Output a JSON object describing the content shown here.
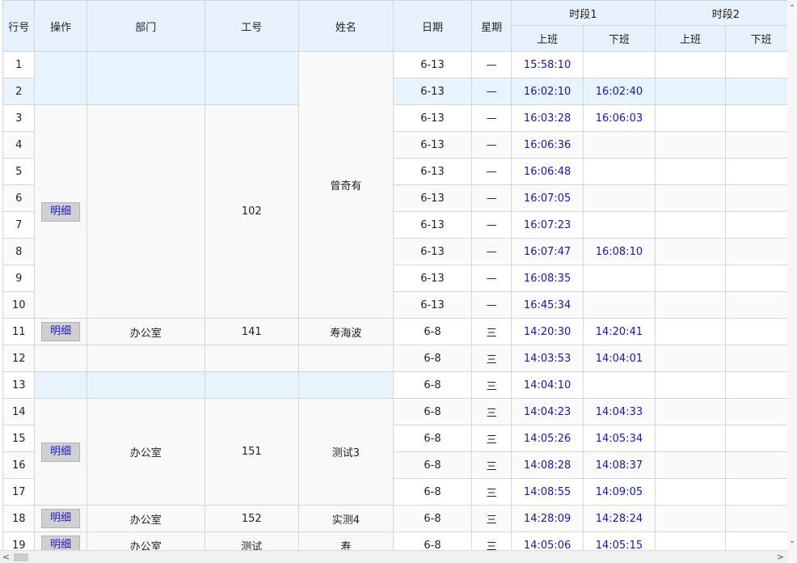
{
  "header": {
    "row_no": "行号",
    "action": "操作",
    "dept": "部门",
    "emp_no": "工号",
    "name": "姓名",
    "date": "日期",
    "weekday": "星期",
    "period1": "时段1",
    "period2": "时段2",
    "on": "上班",
    "off": "下班",
    "on2": "上班",
    "off2": "下班"
  },
  "detail_label": "明细",
  "groups": [
    {
      "dept": "",
      "emp_no": "102",
      "name": "曾奇有"
    },
    {
      "dept": "办公室",
      "emp_no": "141",
      "name": "寿海波"
    },
    {
      "dept": "办公室",
      "emp_no": "151",
      "name": "测试3"
    },
    {
      "dept": "办公室",
      "emp_no": "152",
      "name": "实测4"
    },
    {
      "dept": "办公室",
      "emp_no": "测试",
      "name": "寿"
    }
  ],
  "rows": [
    {
      "no": "1",
      "date": "6-13",
      "weekday": "—",
      "on1": "15:58:10",
      "off1": ""
    },
    {
      "no": "2",
      "date": "6-13",
      "weekday": "—",
      "on1": "16:02:10",
      "off1": "16:02:40"
    },
    {
      "no": "3",
      "date": "6-13",
      "weekday": "—",
      "on1": "16:03:28",
      "off1": "16:06:03"
    },
    {
      "no": "4",
      "date": "6-13",
      "weekday": "—",
      "on1": "16:06:36",
      "off1": ""
    },
    {
      "no": "5",
      "date": "6-13",
      "weekday": "—",
      "on1": "16:06:48",
      "off1": ""
    },
    {
      "no": "6",
      "date": "6-13",
      "weekday": "—",
      "on1": "16:07:05",
      "off1": ""
    },
    {
      "no": "7",
      "date": "6-13",
      "weekday": "—",
      "on1": "16:07:23",
      "off1": ""
    },
    {
      "no": "8",
      "date": "6-13",
      "weekday": "—",
      "on1": "16:07:47",
      "off1": "16:08:10"
    },
    {
      "no": "9",
      "date": "6-13",
      "weekday": "—",
      "on1": "16:08:35",
      "off1": ""
    },
    {
      "no": "10",
      "date": "6-13",
      "weekday": "—",
      "on1": "16:45:34",
      "off1": ""
    },
    {
      "no": "11",
      "date": "6-8",
      "weekday": "三",
      "on1": "14:20:30",
      "off1": "14:20:41"
    },
    {
      "no": "12",
      "date": "6-8",
      "weekday": "三",
      "on1": "14:03:53",
      "off1": "14:04:01"
    },
    {
      "no": "13",
      "date": "6-8",
      "weekday": "三",
      "on1": "14:04:10",
      "off1": ""
    },
    {
      "no": "14",
      "date": "6-8",
      "weekday": "三",
      "on1": "14:04:23",
      "off1": "14:04:33"
    },
    {
      "no": "15",
      "date": "6-8",
      "weekday": "三",
      "on1": "14:05:26",
      "off1": "14:05:34"
    },
    {
      "no": "16",
      "date": "6-8",
      "weekday": "三",
      "on1": "14:08:28",
      "off1": "14:08:37"
    },
    {
      "no": "17",
      "date": "6-8",
      "weekday": "三",
      "on1": "14:08:55",
      "off1": "14:09:05"
    },
    {
      "no": "18",
      "date": "6-8",
      "weekday": "三",
      "on1": "14:28:09",
      "off1": "14:28:24"
    },
    {
      "no": "19",
      "date": "6-8",
      "weekday": "三",
      "on1": "14:05:06",
      "off1": "14:05:15"
    }
  ]
}
